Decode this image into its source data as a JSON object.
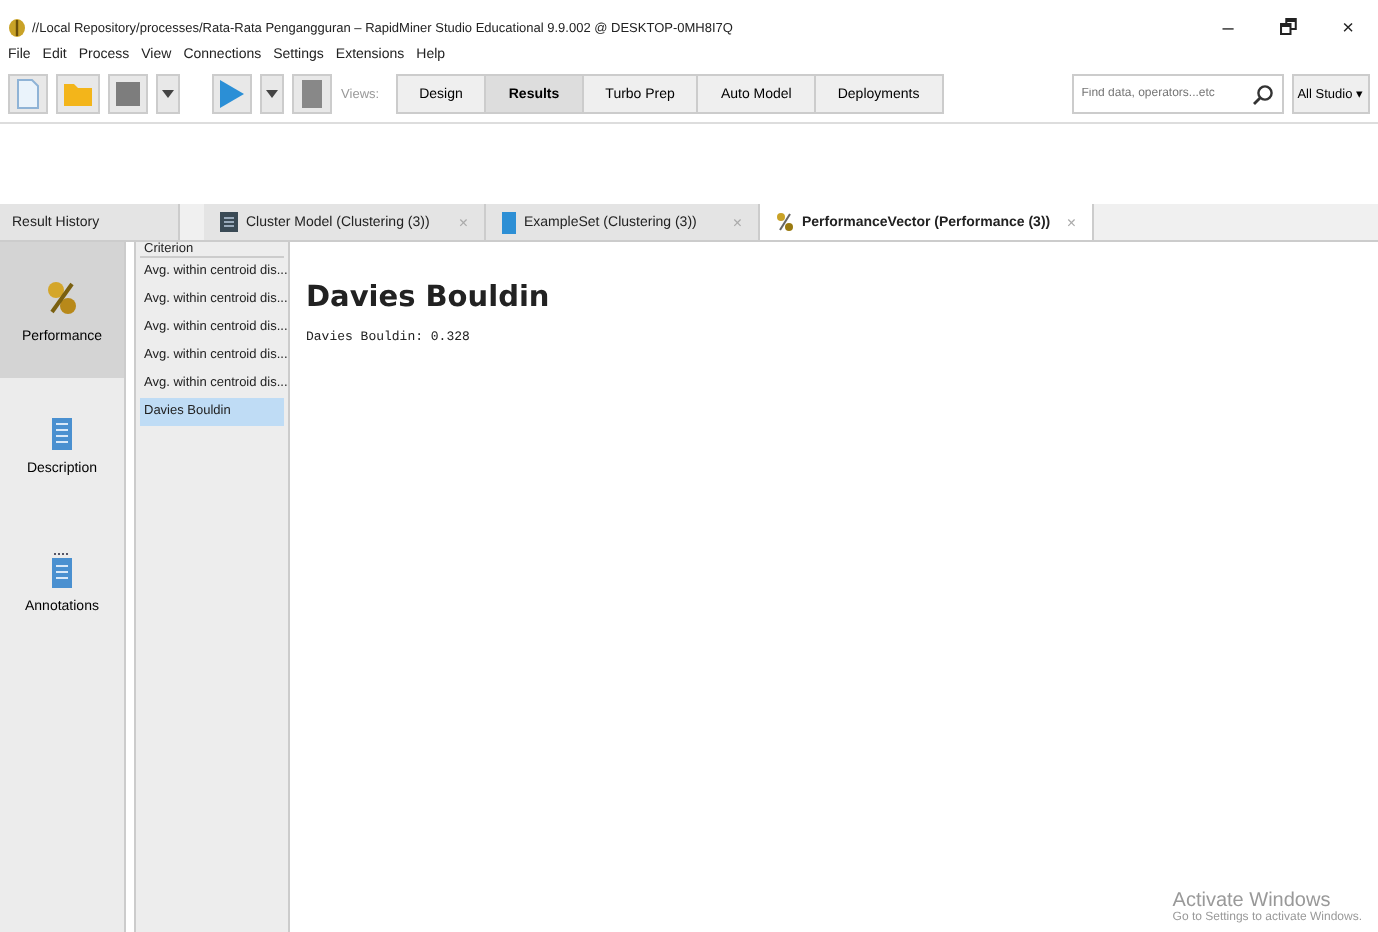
{
  "window": {
    "title": "//Local Repository/processes/Rata-Rata Pengangguran – RapidMiner Studio Educational 9.9.002 @ DESKTOP-0MH8I7Q",
    "controls": [
      "–",
      "🗗",
      "×"
    ]
  },
  "menu": [
    "File",
    "Edit",
    "Process",
    "View",
    "Connections",
    "Settings",
    "Extensions",
    "Help"
  ],
  "toolbar": {
    "views_label": "Views:",
    "views": [
      {
        "label": "Design",
        "selected": false
      },
      {
        "label": "Results",
        "selected": true
      },
      {
        "label": "Turbo Prep",
        "selected": false
      },
      {
        "label": "Auto Model",
        "selected": false
      },
      {
        "label": "Deployments",
        "selected": false
      }
    ],
    "search": {
      "placeholder": "Find data, operators...etc"
    },
    "scope": "All Studio ▾"
  },
  "tabs": [
    {
      "label": "Result History",
      "kind": "plain",
      "selected": false
    },
    {
      "label": "Cluster Model (Clustering (3))",
      "kind": "model",
      "selected": false,
      "close": "×"
    },
    {
      "label": "ExampleSet (Clustering (3))",
      "kind": "table",
      "selected": false,
      "close": "×"
    },
    {
      "label": "PerformanceVector (Performance (3))",
      "kind": "performance",
      "selected": true,
      "close": "×"
    }
  ],
  "side_nav": [
    {
      "label": "Performance",
      "kind": "performance",
      "selected": true
    },
    {
      "label": "Description",
      "kind": "description",
      "selected": false
    },
    {
      "label": "Annotations",
      "kind": "annotations",
      "selected": false
    }
  ],
  "criterion": {
    "title": "Criterion",
    "items": [
      {
        "label": "Avg. within centroid dis...",
        "selected": false
      },
      {
        "label": "Avg. within centroid dis...",
        "selected": false
      },
      {
        "label": "Avg. within centroid dis...",
        "selected": false
      },
      {
        "label": "Avg. within centroid dis...",
        "selected": false
      },
      {
        "label": "Avg. within centroid dis...",
        "selected": false
      },
      {
        "label": "Davies Bouldin",
        "selected": true
      }
    ]
  },
  "result": {
    "heading": "Davies Bouldin",
    "value": "Davies Bouldin: 0.328"
  },
  "activation": {
    "title": "Activate Windows",
    "subtitle": "Go to Settings to activate Windows."
  }
}
